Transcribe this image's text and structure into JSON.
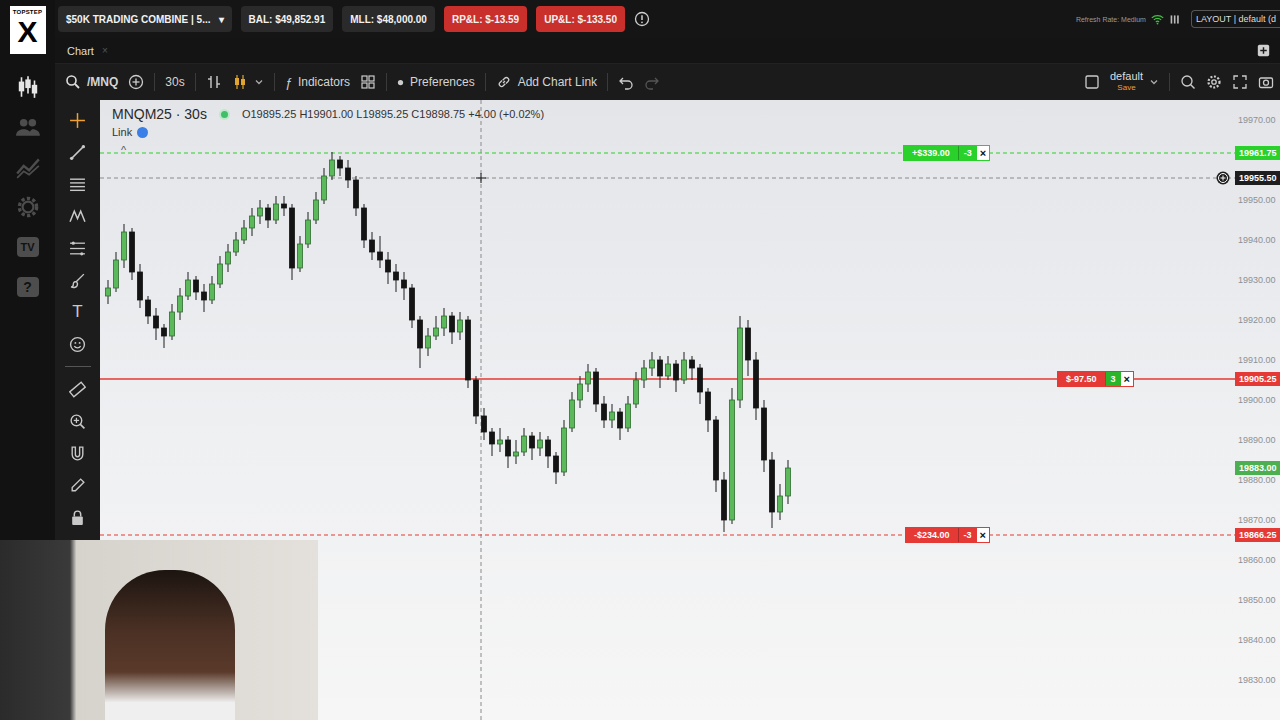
{
  "brand": {
    "wordmark": "TOPSTEP",
    "mark": "X"
  },
  "sidebar": {
    "items": [
      {
        "kind": "chart",
        "selected": true
      },
      {
        "kind": "people",
        "selected": false
      },
      {
        "kind": "trend",
        "selected": false
      },
      {
        "kind": "gear",
        "selected": false
      },
      {
        "kind": "tv",
        "label": "TV",
        "selected": false
      },
      {
        "kind": "help",
        "label": "?",
        "selected": false
      }
    ]
  },
  "topbar": {
    "account": "$50K TRADING COMBINE | 5...",
    "account_caret": "▾",
    "stats": [
      {
        "label": "BAL: $49,852.91",
        "kind": "plain"
      },
      {
        "label": "MLL: $48,000.00",
        "kind": "plain"
      },
      {
        "label": "RP&L: $-13.59",
        "kind": "loss"
      },
      {
        "label": "UP&L: $-133.50",
        "kind": "loss"
      }
    ],
    "refresh": "Refresh Rate: Medium",
    "layout": "LAYOUT | default (d"
  },
  "tabs": [
    {
      "label": "Chart",
      "close": "×",
      "selected": true
    }
  ],
  "toolbar": {
    "symbol": "/MNQ",
    "interval": "30s",
    "chart_types": [
      {
        "kind": "bars",
        "selected": false
      },
      {
        "kind": "candles",
        "selected": true
      }
    ],
    "indicators": "Indicators",
    "preferences": "Preferences",
    "chart_link": "Add Chart Link",
    "undo_enabled": true,
    "redo_enabled": false,
    "layout": {
      "name": "default",
      "action": "Save"
    }
  },
  "draw_tools": [
    {
      "kind": "crosshair",
      "selected": true
    },
    {
      "kind": "line",
      "selected": false
    },
    {
      "kind": "hlines",
      "selected": false
    },
    {
      "kind": "pattern",
      "selected": false
    },
    {
      "kind": "fib",
      "selected": false
    },
    {
      "kind": "brush",
      "selected": false
    },
    {
      "kind": "text",
      "label": "T",
      "selected": false
    },
    {
      "kind": "emoji",
      "selected": false
    },
    {
      "kind": "ruler",
      "selected": false
    },
    {
      "kind": "zoom",
      "selected": false
    },
    {
      "kind": "magnet",
      "selected": false
    },
    {
      "kind": "pen",
      "selected": false
    },
    {
      "kind": "lock",
      "selected": false
    },
    {
      "kind": "eye",
      "selected": false
    }
  ],
  "chart": {
    "title": "MNQM25 · 30s",
    "live": true,
    "ohlc": "O19895.25 H19901.00 L19895.25 C19898.75 +4.00 (+0.02%)",
    "link": "Link",
    "collapse": "^",
    "ticks": [
      "19970.00",
      "19950.00",
      "19940.00",
      "19930.00",
      "19920.00",
      "19910.00",
      "19900.00",
      "19890.00",
      "19880.00",
      "19870.00",
      "19860.00",
      "19850.00",
      "19840.00",
      "19830.00"
    ],
    "levels": [
      {
        "kind": "target",
        "price": 19961.75,
        "axis_label": "19961.75",
        "pnl": "+$339.00",
        "qty": "-3",
        "close": "×",
        "color": "#2bd12b",
        "qty_color": "#2bd12b"
      },
      {
        "kind": "entry",
        "price": 19905.25,
        "axis_label": "19905.25",
        "pnl": "$-97.50",
        "qty": "3",
        "close": "×",
        "color": "#e53935",
        "qty_color": "#2bb52b"
      },
      {
        "kind": "stop",
        "price": 19866.25,
        "axis_label": "19866.25",
        "pnl": "-$234.00",
        "qty": "-3",
        "close": "×",
        "color": "#e53935",
        "qty_color": "#e53935"
      }
    ],
    "last_price": {
      "price": 19883.0,
      "label": "19883.00",
      "color": "#4caf50"
    },
    "crosshair": {
      "price": 19955.5,
      "label": "19955.50",
      "bar": 46.625
    },
    "candles": [
      [
        19926,
        19930,
        19924,
        19928
      ],
      [
        19928,
        19937,
        19927,
        19935
      ],
      [
        19935,
        19944,
        19933,
        19942
      ],
      [
        19942,
        19943,
        19930,
        19932
      ],
      [
        19932,
        19934,
        19923,
        19925
      ],
      [
        19925,
        19926,
        19919,
        19921
      ],
      [
        19921,
        19923,
        19915,
        19918
      ],
      [
        19918,
        19919,
        19913,
        19916
      ],
      [
        19916,
        19924,
        19915,
        19922
      ],
      [
        19922,
        19928,
        19920,
        19926
      ],
      [
        19926,
        19932,
        19925,
        19930
      ],
      [
        19930,
        19931,
        19925,
        19927
      ],
      [
        19927,
        19929,
        19922,
        19925
      ],
      [
        19925,
        19931,
        19924,
        19929
      ],
      [
        19929,
        19936,
        19928,
        19934
      ],
      [
        19934,
        19939,
        19932,
        19937
      ],
      [
        19937,
        19942,
        19936,
        19940
      ],
      [
        19940,
        19945,
        19939,
        19943
      ],
      [
        19943,
        19948,
        19941,
        19946
      ],
      [
        19946,
        19950,
        19944,
        19948
      ],
      [
        19948,
        19949,
        19943,
        19945
      ],
      [
        19945,
        19951,
        19944,
        19949
      ],
      [
        19949,
        19951,
        19946,
        19948
      ],
      [
        19948,
        19949,
        19930,
        19933
      ],
      [
        19933,
        19941,
        19932,
        19939
      ],
      [
        19939,
        19947,
        19938,
        19945
      ],
      [
        19945,
        19952,
        19944,
        19950
      ],
      [
        19950,
        19958,
        19949,
        19956
      ],
      [
        19956,
        19962,
        19955,
        19960
      ],
      [
        19960,
        19961,
        19956,
        19958
      ],
      [
        19958,
        19960,
        19953,
        19955
      ],
      [
        19955,
        19956,
        19946,
        19948
      ],
      [
        19948,
        19949,
        19938,
        19940
      ],
      [
        19940,
        19942,
        19935,
        19937
      ],
      [
        19937,
        19941,
        19933,
        19935
      ],
      [
        19935,
        19937,
        19929,
        19932
      ],
      [
        19932,
        19934,
        19927,
        19930
      ],
      [
        19930,
        19932,
        19925,
        19928
      ],
      [
        19928,
        19929,
        19918,
        19920
      ],
      [
        19920,
        19921,
        19908,
        19913
      ],
      [
        19913,
        19918,
        19911,
        19916
      ],
      [
        19916,
        19921,
        19915,
        19918
      ],
      [
        19918,
        19923,
        19916,
        19921
      ],
      [
        19921,
        19922,
        19914,
        19917
      ],
      [
        19917,
        19922,
        19915,
        19920
      ],
      [
        19920,
        19921,
        19903,
        19905
      ],
      [
        19905,
        19906,
        19894,
        19896
      ],
      [
        19896,
        19898,
        19890,
        19892
      ],
      [
        19892,
        19893,
        19886,
        19889
      ],
      [
        19889,
        19893,
        19887,
        19890
      ],
      [
        19890,
        19891,
        19883,
        19886
      ],
      [
        19886,
        19890,
        19884,
        19887
      ],
      [
        19887,
        19893,
        19886,
        19891
      ],
      [
        19891,
        19892,
        19885,
        19888
      ],
      [
        19888,
        19892,
        19886,
        19890
      ],
      [
        19890,
        19891,
        19883,
        19886
      ],
      [
        19886,
        19887,
        19879,
        19882
      ],
      [
        19882,
        19895,
        19881,
        19893
      ],
      [
        19893,
        19902,
        19892,
        19900
      ],
      [
        19900,
        19906,
        19898,
        19904
      ],
      [
        19904,
        19909,
        19902,
        19907
      ],
      [
        19907,
        19908,
        19897,
        19899
      ],
      [
        19899,
        19901,
        19893,
        19895
      ],
      [
        19895,
        19899,
        19893,
        19897
      ],
      [
        19897,
        19898,
        19890,
        19893
      ],
      [
        19893,
        19901,
        19892,
        19899
      ],
      [
        19899,
        19907,
        19898,
        19905
      ],
      [
        19905,
        19910,
        19903,
        19908
      ],
      [
        19908,
        19912,
        19906,
        19910
      ],
      [
        19910,
        19911,
        19903,
        19906
      ],
      [
        19906,
        19911,
        19905,
        19909
      ],
      [
        19909,
        19910,
        19902,
        19905
      ],
      [
        19905,
        19912,
        19904,
        19910
      ],
      [
        19910,
        19911,
        19905,
        19908
      ],
      [
        19908,
        19909,
        19899,
        19902
      ],
      [
        19902,
        19903,
        19892,
        19895
      ],
      [
        19895,
        19896,
        19877,
        19880
      ],
      [
        19880,
        19882,
        19867,
        19870
      ],
      [
        19870,
        19903,
        19869,
        19900
      ],
      [
        19900,
        19921,
        19898,
        19918
      ],
      [
        19918,
        19920,
        19906,
        19910
      ],
      [
        19910,
        19912,
        19895,
        19898
      ],
      [
        19898,
        19900,
        19882,
        19885
      ],
      [
        19885,
        19887,
        19868,
        19872
      ],
      [
        19872,
        19879,
        19870,
        19876
      ],
      [
        19876,
        19885,
        19874,
        19883
      ]
    ]
  }
}
